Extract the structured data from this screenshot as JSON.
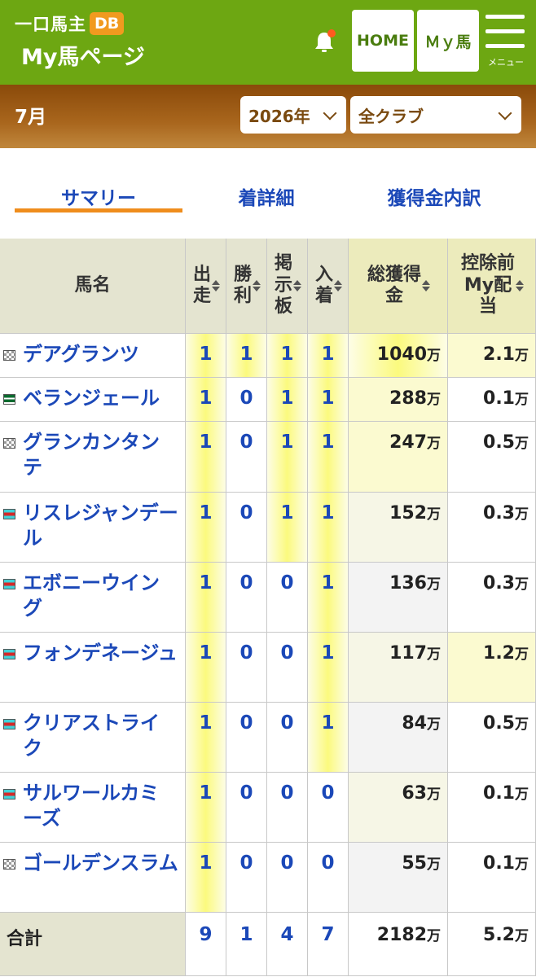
{
  "header": {
    "logo_text": "一口馬主",
    "logo_badge": "DB",
    "page_title": "My馬ページ",
    "home_label": "HOME",
    "myuma_label": "Ｍｙ馬",
    "menu_label": "メニュー",
    "bell_color": "#ff5a1f"
  },
  "filters": {
    "month": "7月",
    "year": "2026年",
    "club": "全クラブ"
  },
  "tabs": [
    {
      "label": "サマリー",
      "active": true
    },
    {
      "label": "着詳細",
      "active": false
    },
    {
      "label": "獲得金内訳",
      "active": false
    }
  ],
  "table": {
    "headers": {
      "name": "馬名",
      "starts": [
        "出",
        "走"
      ],
      "wins": [
        "勝",
        "利"
      ],
      "board": [
        "掲",
        "示",
        "板"
      ],
      "placed": [
        "入",
        "着"
      ],
      "total": [
        "総獲得",
        "金"
      ],
      "my": [
        "控除前",
        "My配",
        "当"
      ]
    },
    "rows": [
      {
        "name": "デアグランツ",
        "starts": "1",
        "wins": "1",
        "board": "1",
        "placed": "1",
        "total": "1040",
        "my": "2.1"
      },
      {
        "name": "ベランジェール",
        "starts": "1",
        "wins": "0",
        "board": "1",
        "placed": "1",
        "total": "288",
        "my": "0.1"
      },
      {
        "name": "グランカンタンテ",
        "starts": "1",
        "wins": "0",
        "board": "1",
        "placed": "1",
        "total": "247",
        "my": "0.5"
      },
      {
        "name": "リスレジャンデール",
        "starts": "1",
        "wins": "0",
        "board": "1",
        "placed": "1",
        "total": "152",
        "my": "0.3"
      },
      {
        "name": "エボニーウイング",
        "starts": "1",
        "wins": "0",
        "board": "0",
        "placed": "1",
        "total": "136",
        "my": "0.3"
      },
      {
        "name": "フォンデネージュ",
        "starts": "1",
        "wins": "0",
        "board": "0",
        "placed": "1",
        "total": "117",
        "my": "1.2"
      },
      {
        "name": "クリアストライク",
        "starts": "1",
        "wins": "0",
        "board": "0",
        "placed": "1",
        "total": "84",
        "my": "0.5"
      },
      {
        "name": "サルワールカミーズ",
        "starts": "1",
        "wins": "0",
        "board": "0",
        "placed": "0",
        "total": "63",
        "my": "0.1"
      },
      {
        "name": "ゴールデンスラム",
        "starts": "1",
        "wins": "0",
        "board": "0",
        "placed": "0",
        "total": "55",
        "my": "0.1"
      }
    ],
    "unit": "万",
    "total_row": {
      "label": "合計",
      "starts": "9",
      "wins": "1",
      "board": "4",
      "placed": "7",
      "total": "2182",
      "my": "5.2"
    }
  }
}
